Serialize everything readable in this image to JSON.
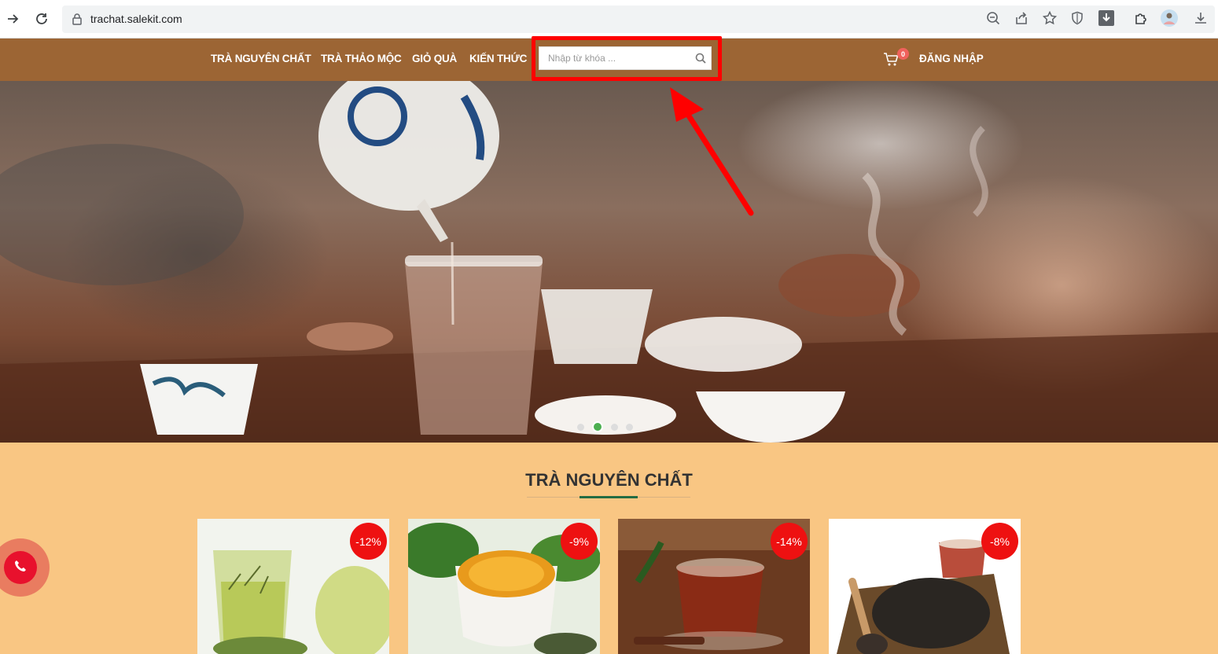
{
  "browser": {
    "url": "trachat.salekit.com"
  },
  "header": {
    "menu": [
      "TRÀ NGUYÊN CHẤT",
      "TRÀ THẢO MỘC",
      "GIỎ QUÀ",
      "KIẾN THỨC"
    ],
    "search_placeholder": "Nhập từ khóa ...",
    "cart_count": "0",
    "login_label": "ĐĂNG NHẬP",
    "header_color": "#9c6534",
    "highlight_color": "#ff0000"
  },
  "hero": {
    "slide_count": 4,
    "active_slide": 2
  },
  "section": {
    "title": "TRÀ NGUYÊN CHẤT",
    "accent_color": "#226c43"
  },
  "products": [
    {
      "discount": "-12%"
    },
    {
      "discount": "-9%"
    },
    {
      "discount": "-14%"
    },
    {
      "discount": "-8%"
    }
  ],
  "floating": {
    "icon": "phone-icon"
  }
}
